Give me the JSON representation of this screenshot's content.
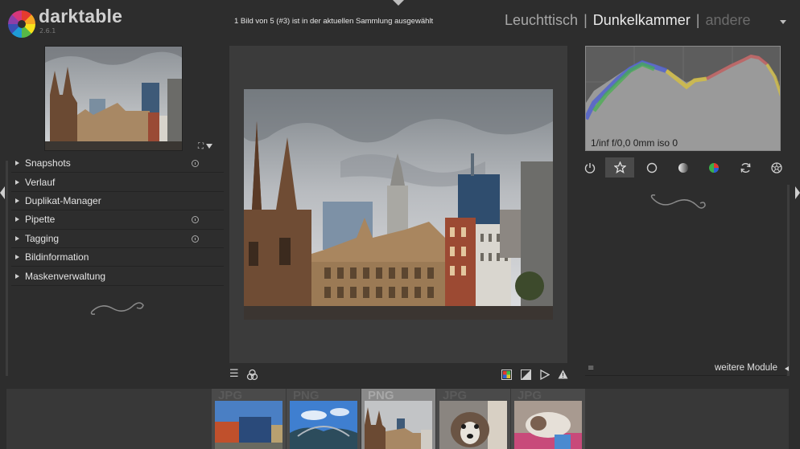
{
  "app": {
    "name": "darktable",
    "version": "2.6.1"
  },
  "header": {
    "status_message": "1 Bild von 5 (#3) ist in der aktuellen Sammlung ausgewählt",
    "views": {
      "lighttable": "Leuchttisch",
      "separator": "|",
      "darkroom": "Dunkelkammer",
      "other": "andere"
    }
  },
  "left_panel": {
    "modules": [
      {
        "label": "Snapshots",
        "has_preset": true
      },
      {
        "label": "Verlauf",
        "has_preset": false
      },
      {
        "label": "Duplikat-Manager",
        "has_preset": false
      },
      {
        "label": "Pipette",
        "has_preset": true
      },
      {
        "label": "Tagging",
        "has_preset": true
      },
      {
        "label": "Bildinformation",
        "has_preset": false
      },
      {
        "label": "Maskenverwaltung",
        "has_preset": false
      }
    ]
  },
  "right_panel": {
    "histogram_info": "1/inf f/0,0 0mm iso 0",
    "module_groups": [
      "power-icon",
      "star-icon",
      "circle-icon",
      "tone-icon",
      "color-icon",
      "correct-icon",
      "effect-icon"
    ],
    "active_group": 1,
    "more_modules_label": "weitere Module"
  },
  "filmstrip": {
    "thumbnails": [
      {
        "ext": "JPG",
        "selected": false
      },
      {
        "ext": "PNG",
        "selected": false
      },
      {
        "ext": "PNG",
        "selected": true
      },
      {
        "ext": "JPG",
        "selected": false
      },
      {
        "ext": "JPG",
        "selected": false
      }
    ]
  }
}
